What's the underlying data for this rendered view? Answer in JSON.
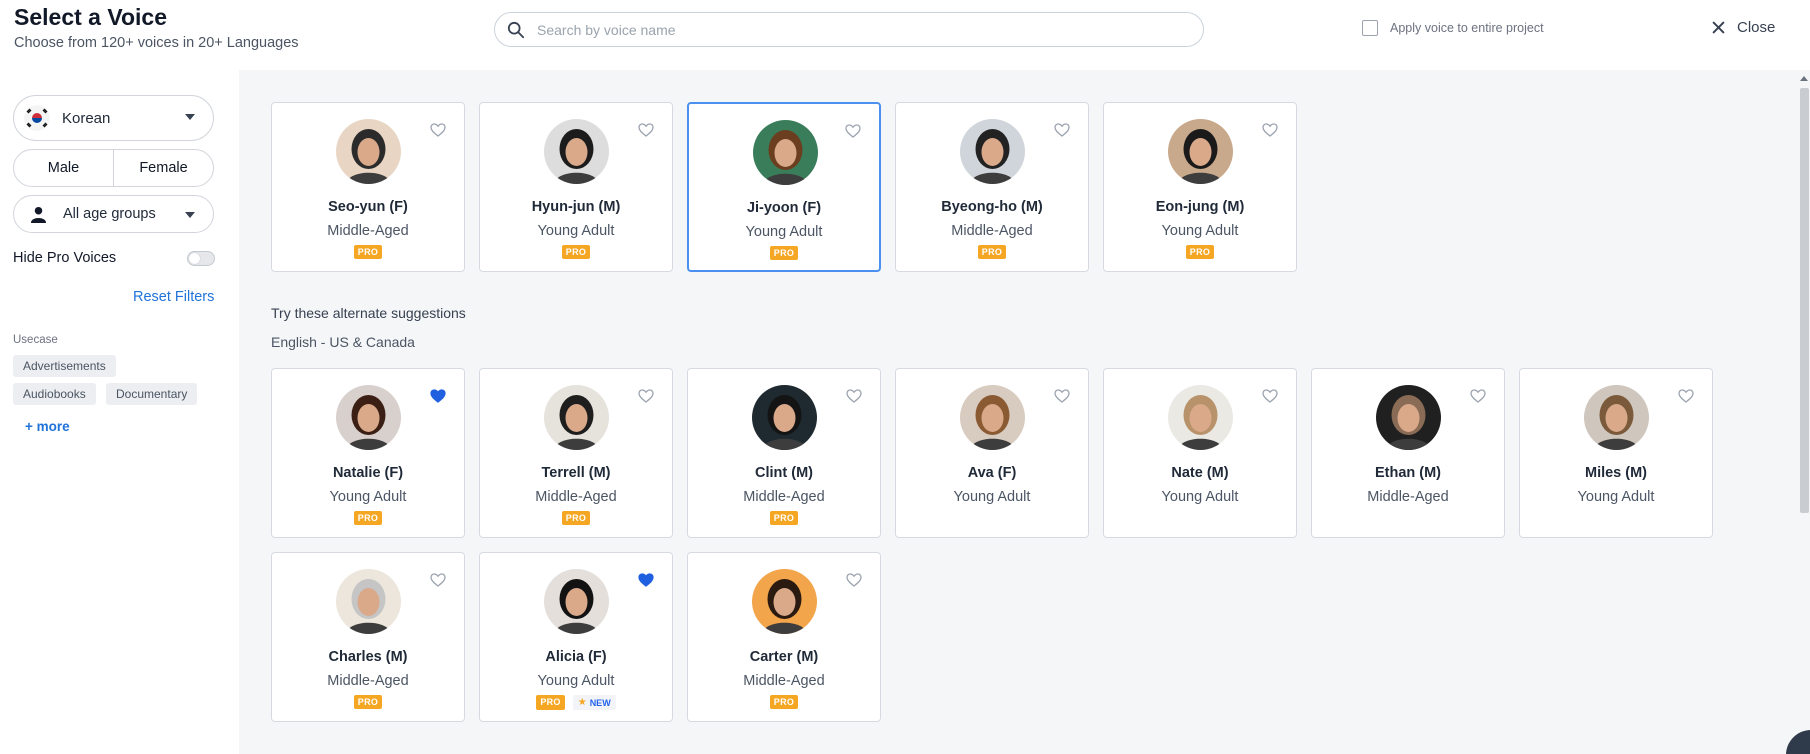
{
  "header": {
    "title": "Select a Voice",
    "subtitle": "Choose from 120+ voices in 20+ Languages",
    "search_placeholder": "Search by voice name",
    "apply_label": "Apply voice to entire project",
    "close_label": "Close"
  },
  "sidebar": {
    "language": "Korean",
    "gender_options": [
      "Male",
      "Female"
    ],
    "age_group": "All age groups",
    "hide_pro_label": "Hide Pro Voices",
    "hide_pro_on": false,
    "reset_label": "Reset Filters",
    "usecase_label": "Usecase",
    "usecase_tags": [
      "Advertisements",
      "Audiobooks",
      "Documentary"
    ],
    "more_label": "+ more"
  },
  "main": {
    "suggest_label": "Try these alternate suggestions",
    "region_label": "English - US & Canada",
    "korean_voices": [
      {
        "name": "Seo-yun (F)",
        "age": "Middle-Aged",
        "pro": "PRO",
        "favorite": false,
        "selected": false
      },
      {
        "name": "Hyun-jun (M)",
        "age": "Young Adult",
        "pro": "PRO",
        "favorite": false,
        "selected": false
      },
      {
        "name": "Ji-yoon (F)",
        "age": "Young Adult",
        "pro": "PRO",
        "favorite": false,
        "selected": true
      },
      {
        "name": "Byeong-ho (M)",
        "age": "Middle-Aged",
        "pro": "PRO",
        "favorite": false,
        "selected": false
      },
      {
        "name": "Eon-jung (M)",
        "age": "Young Adult",
        "pro": "PRO",
        "favorite": false,
        "selected": false
      }
    ],
    "english_voices": [
      {
        "name": "Natalie (F)",
        "age": "Young Adult",
        "pro": "PRO",
        "favorite": true
      },
      {
        "name": "Terrell (M)",
        "age": "Middle-Aged",
        "pro": "PRO",
        "favorite": false
      },
      {
        "name": "Clint (M)",
        "age": "Middle-Aged",
        "pro": "PRO",
        "favorite": false
      },
      {
        "name": "Ava (F)",
        "age": "Young Adult",
        "pro": "",
        "favorite": false
      },
      {
        "name": "Nate (M)",
        "age": "Young Adult",
        "pro": "",
        "favorite": false
      },
      {
        "name": "Ethan (M)",
        "age": "Middle-Aged",
        "pro": "",
        "favorite": false
      },
      {
        "name": "Miles (M)",
        "age": "Young Adult",
        "pro": "",
        "favorite": false
      },
      {
        "name": "Charles (M)",
        "age": "Middle-Aged",
        "pro": "PRO",
        "favorite": false
      },
      {
        "name": "Alicia (F)",
        "age": "Young Adult",
        "pro": "PRO",
        "new": "NEW",
        "favorite": true
      },
      {
        "name": "Carter (M)",
        "age": "Middle-Aged",
        "pro": "PRO",
        "favorite": false
      }
    ]
  },
  "colors": {
    "accent": "#1f73d9",
    "favorite": "#1f5fe0",
    "pro_badge": "#f5a623",
    "selected_border": "#4b8ff0"
  }
}
